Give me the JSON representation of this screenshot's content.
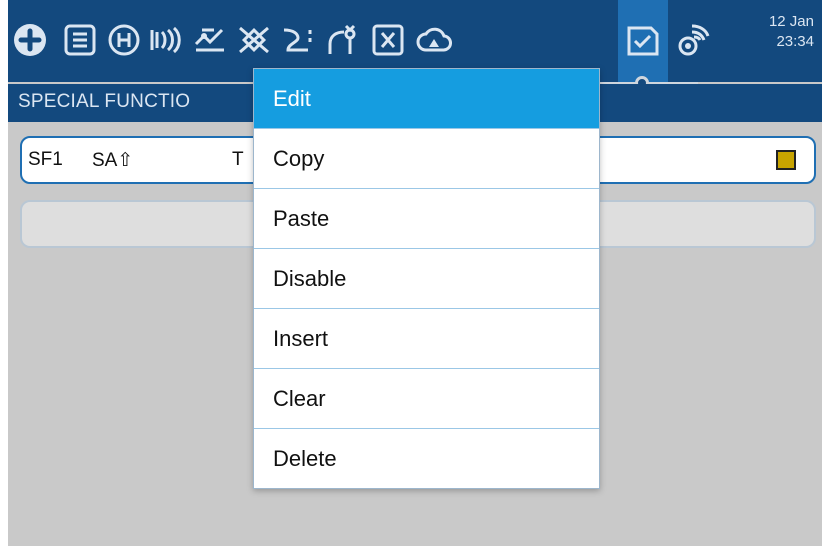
{
  "toolbar": {
    "icons": [
      "radio-setup-icon",
      "model-list-icon",
      "heli-icon",
      "inputs-icon",
      "mixes-icon",
      "outputs-icon",
      "curves-icon",
      "logical-switches-icon",
      "variables-icon",
      "telemetry-icon",
      "special-functions-icon",
      "sensors-icon"
    ],
    "clock": {
      "date": "12 Jan",
      "time": "23:34"
    }
  },
  "title": "SPECIAL FUNCTIO",
  "rows": [
    {
      "id": "SF1",
      "switch": "SA⇧",
      "function_fragment": "T"
    }
  ],
  "menu": {
    "items": [
      "Edit",
      "Copy",
      "Paste",
      "Disable",
      "Insert",
      "Clear",
      "Delete"
    ],
    "selected": "Edit"
  },
  "colors": {
    "toolbar_bg": "#13497e",
    "active_tab": "#1f6fb3",
    "selected_item": "#159de0",
    "checkbox": "#c8a400"
  }
}
